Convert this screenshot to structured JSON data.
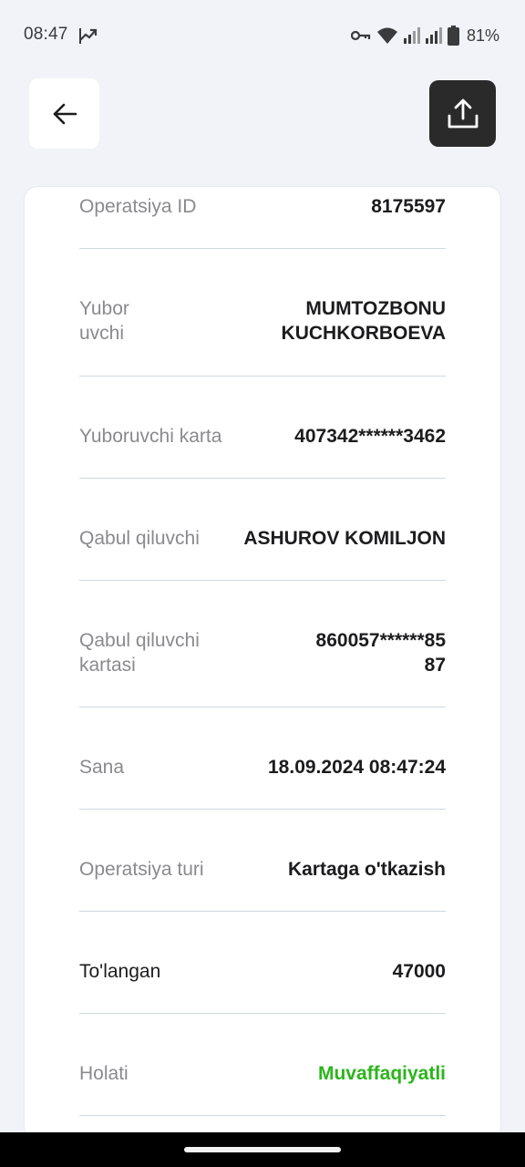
{
  "status_bar": {
    "time": "08:47",
    "battery_percent": "81%",
    "icons": [
      "trending-up-icon",
      "key-icon",
      "wifi-icon",
      "signal-icon",
      "signal-icon",
      "battery-icon"
    ]
  },
  "header": {
    "back_icon": "arrow-left-icon",
    "share_icon": "share-upload-icon"
  },
  "details": {
    "operation_id": {
      "label": "Operatsiya ID",
      "value": "8175597"
    },
    "sender": {
      "label_line1": "Yubor",
      "label_line2": "uvchi",
      "value_line1": "MUMTOZBONU",
      "value_line2": "KUCHKORBOEVA"
    },
    "sender_card": {
      "label": "Yuboruvchi karta",
      "value": "407342******3462"
    },
    "receiver": {
      "label": "Qabul qiluvchi",
      "value": "ASHUROV KOMILJON"
    },
    "receiver_card": {
      "label_line1": "Qabul qiluvchi",
      "label_line2": "kartasi",
      "value_line1": "860057******85",
      "value_line2": "87"
    },
    "date": {
      "label": "Sana",
      "value": "18.09.2024 08:47:24"
    },
    "operation_type": {
      "label": "Operatsiya turi",
      "value": "Kartaga o'tkazish"
    },
    "paid": {
      "label": "To'langan",
      "value": "47000"
    },
    "status": {
      "label": "Holati",
      "value": "Muvaffaqiyatli"
    }
  },
  "colors": {
    "background": "#f1f3f8",
    "card": "#ffffff",
    "share_button": "#2a2a2a",
    "success": "#2bb51b",
    "divider": "#cfd8e0",
    "label": "#8a8a8e"
  }
}
